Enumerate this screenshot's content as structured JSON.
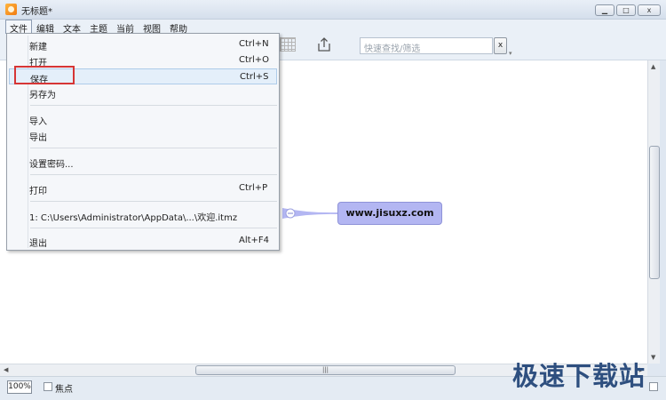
{
  "window": {
    "title": "无标题*",
    "controls": {
      "minimize": "▁",
      "maximize": "□",
      "close": "x"
    }
  },
  "menubar": [
    {
      "label": "文件",
      "active": true
    },
    {
      "label": "编辑"
    },
    {
      "label": "文本"
    },
    {
      "label": "主题"
    },
    {
      "label": "当前"
    },
    {
      "label": "视图"
    },
    {
      "label": "帮助"
    }
  ],
  "toolbar": {
    "search_placeholder": "快速查找/筛选",
    "clear_label": "x"
  },
  "file_menu": {
    "items": [
      {
        "label": "新建",
        "shortcut": "Ctrl+N"
      },
      {
        "label": "打开",
        "shortcut": "Ctrl+O"
      },
      {
        "label": "保存",
        "shortcut": "Ctrl+S"
      },
      {
        "label": "另存为",
        "shortcut": ""
      },
      {
        "label": "导入",
        "shortcut": ""
      },
      {
        "label": "导出",
        "shortcut": ""
      },
      {
        "label": "设置密码...",
        "shortcut": ""
      },
      {
        "label": "打印",
        "shortcut": "Ctrl+P"
      },
      {
        "label": "1:  C:\\Users\\Administrator\\AppData\\...\\欢迎.itmz",
        "shortcut": ""
      },
      {
        "label": "退出",
        "shortcut": "Alt+F4"
      }
    ],
    "hovered": "保存"
  },
  "canvas": {
    "node_text": "www.jisuxz.com"
  },
  "statusbar": {
    "zoom": "100%",
    "focus_label": "焦点"
  },
  "watermark": "极速下载站",
  "colors": {
    "node_fill": "#b3b6f2",
    "highlight_box": "#d63535",
    "menu_hover": "#e4effa"
  }
}
